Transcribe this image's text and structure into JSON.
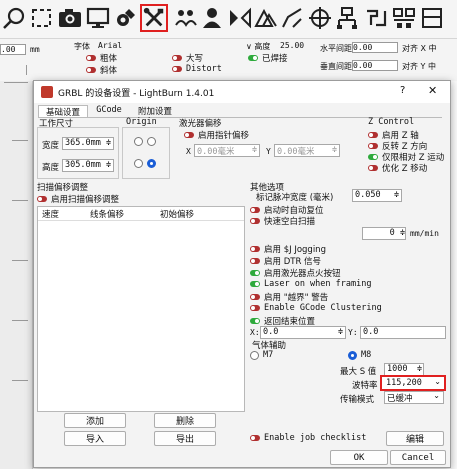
{
  "toolbar": {
    "icons": [
      "search-icon",
      "select-frame-icon",
      "camera-icon",
      "monitor-icon",
      "gear-edit-icon",
      "tools-icon",
      "group-icon",
      "person-icon",
      "mirror-icon",
      "array-icon",
      "edit-path-icon",
      "crosshair-icon",
      "node-icon",
      "combine-icon",
      "align-icon",
      "more-icon"
    ]
  },
  "bar2": {
    "left_value": ".00",
    "left_unit": "mm",
    "font_label": "字体",
    "font_value": "Arial",
    "bold": "粗体",
    "italic": "斜体",
    "upper": "大写",
    "distort": "Distort",
    "height_label": "高度",
    "height_value": "25.00",
    "welded": "已焊接",
    "hspace_label": "水平间距",
    "hspace_value": "0.00",
    "vspace_label": "垂直间距",
    "vspace_value": "0.00",
    "alignx": "对齐 X 中",
    "aligny": "对齐 Y 中"
  },
  "dialog": {
    "title": "GRBL 的设备设置 - LightBurn 1.4.01",
    "help": "?",
    "close": "✕",
    "tabs": [
      "基础设置",
      "GCode",
      "附加设置"
    ],
    "work_size": {
      "title": "工作尺寸",
      "width_label": "宽度",
      "width_value": "365.0mm",
      "height_label": "高度",
      "height_value": "305.0mm"
    },
    "origin_title": "Origin",
    "laser_offset": {
      "title": "激光器偏移",
      "enable": "启用指针偏移",
      "x": "X",
      "x_value": "0.00毫米",
      "y": "Y",
      "y_value": "0.00毫米"
    },
    "zcontrol": {
      "title": "Z Control",
      "items": [
        "启用 Z 轴",
        "反转 Z 方向",
        "仅限相对 Z 运动",
        "优化 Z 移动"
      ],
      "states": [
        false,
        false,
        true,
        false
      ]
    },
    "scan": {
      "title": "扫描偏移调整",
      "enable": "启用扫描偏移调整",
      "headers": [
        "速度",
        "线条偏移",
        "初始偏移"
      ],
      "add": "添加",
      "delete": "删除",
      "import": "导入",
      "export": "导出"
    },
    "other": {
      "title": "其他选项",
      "pulse_label": "标记脉冲宽度 (毫米)",
      "pulse_value": "0.050",
      "items": [
        {
          "label": "启动时自动复位",
          "on": false
        },
        {
          "label": "快速空白扫描",
          "on": false
        }
      ],
      "speed_value": "0",
      "speed_unit": "mm/min",
      "items2": [
        {
          "label": "启用 $J Jogging",
          "on": false
        },
        {
          "label": "启用 DTR 信号",
          "on": false
        },
        {
          "label": "启用激光器点火按钮",
          "on": true
        },
        {
          "label": "Laser on when framing",
          "on": true
        },
        {
          "label": "启用 \"越界\" 警告",
          "on": false
        },
        {
          "label": "Enable GCode Clustering",
          "on": false
        },
        {
          "label": "返回结束位置",
          "on": true
        }
      ],
      "x_label": "X:",
      "x_value": "0.0",
      "y_label": "Y:",
      "y_value": "0.0",
      "air_title": "气体辅助",
      "m7": "M7",
      "m8": "M8",
      "max_s_label": "最大 S 值",
      "max_s_value": "1000",
      "baud_label": "波特率",
      "baud_value": "115,200",
      "transfer_label": "传输模式",
      "transfer_value": "已缓冲"
    },
    "job_checklist": "Enable job checklist",
    "edit": "编辑",
    "ok": "OK",
    "cancel": "Cancel"
  }
}
